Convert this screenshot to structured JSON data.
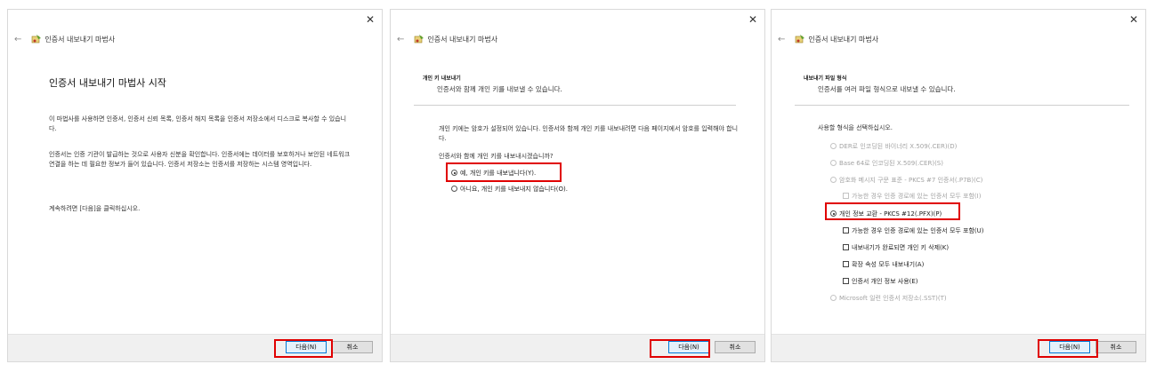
{
  "panels": [
    {
      "title": "인증서 내보내기 마법사",
      "heading": "인증서 내보내기 마법사 시작",
      "paragraphs": [
        "이 마법사를 사용하면 인증서, 인증서 신뢰 목록, 인증서 해지 목록을 인증서 저장소에서 디스크로 복사할 수 있습니다.",
        "인증서는 인증 기관이 발급하는 것으로 사용자 신분을 확인합니다. 인증서에는 데이터를 보호하거나 보안된 네트워크 연결을 하는 데 필요한 정보가 들어 있습니다. 인증서 저장소는 인증서를 저장하는 시스템 영역입니다.",
        "계속하려면 [다음]을 클릭하십시오."
      ],
      "next_label": "다음(N)",
      "cancel_label": "취소"
    },
    {
      "title": "인증서 내보내기 마법사",
      "subtitle": "개인 키 내보내기",
      "subdesc": "인증서와 함께 개인 키를 내보낼 수 있습니다.",
      "paragraph": "개인 키에는 암호가 설정되어 있습니다. 인증서와 함께 개인 키를 내보내려면 다음 페이지에서 암호를 입력해야 합니다.",
      "question": "인증서와 함께 개인 키를 내보내시겠습니까?",
      "options": [
        "예, 개인 키를 내보냅니다(Y).",
        "아니요, 개인 키를 내보내지 않습니다(O)."
      ],
      "selected": 0,
      "next_label": "다음(N)",
      "cancel_label": "취소"
    },
    {
      "title": "인증서 내보내기 마법사",
      "subtitle": "내보내기 파일 형식",
      "subdesc": "인증서를 여러 파일 형식으로 내보낼 수 있습니다.",
      "prompt": "사용할 형식을 선택하십시오.",
      "formats": [
        "DER로 인코딩된 바이너리 X.509(.CER)(D)",
        "Base 64로 인코딩된 X.509(.CER)(S)",
        "암호화 메시지 구문 표준 - PKCS #7 인증서(.P7B)(C)",
        "개인 정보 교환 - PKCS #12(.PFX)(P)",
        "Microsoft 일련 인증서 저장소(.SST)(T)"
      ],
      "p7b_checkbox": "가능한 경우 인증 경로에 있는 인증서 모두 포함(I)",
      "pfx_checkboxes": [
        "가능한 경우 인증 경로에 있는 인증서 모두 포함(U)",
        "내보내기가 완료되면 개인 키 삭제(K)",
        "확장 속성 모두 내보내기(A)",
        "인증서 개인 정보 사용(E)"
      ],
      "selected_format": 3,
      "next_label": "다음(N)",
      "cancel_label": "취소"
    }
  ],
  "icons": {
    "close": "close-icon",
    "back": "back-arrow-icon",
    "wizard": "certificate-wizard-icon"
  },
  "colors": {
    "highlight": "#e00000",
    "footer": "#f0f0f0",
    "default_button_border": "#0078d7"
  }
}
